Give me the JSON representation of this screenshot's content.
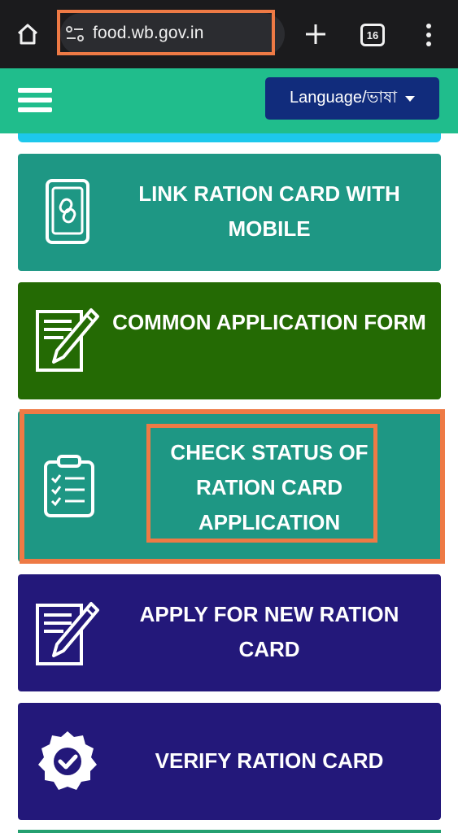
{
  "browser": {
    "url": "food.wb.gov.in",
    "tab_count": "16",
    "icons": {
      "home": "home-icon",
      "site_info": "site-settings-icon",
      "new_tab": "plus-icon",
      "tabs": "tab-switcher-icon",
      "menu": "more-vert-icon"
    }
  },
  "header": {
    "menu_icon": "hamburger-menu-icon",
    "language_button": "Language/ভাষা"
  },
  "cards": [
    {
      "label": "LINK RATION CARD WITH MOBILE",
      "icon": "mobile-link-icon",
      "color": "#1e9784"
    },
    {
      "label": "COMMON APPLICATION FORM",
      "icon": "form-pencil-icon",
      "color": "#246a04"
    },
    {
      "label": "CHECK STATUS OF RATION CARD APPLICATION",
      "icon": "clipboard-checklist-icon",
      "color": "#1e9784"
    },
    {
      "label": "APPLY FOR NEW RATION CARD",
      "icon": "form-pencil-icon",
      "color": "#23187a"
    },
    {
      "label": "VERIFY RATION CARD",
      "icon": "verified-badge-icon",
      "color": "#23187a"
    }
  ],
  "colors": {
    "header_green": "#20bd8c",
    "language_button": "#112c7c",
    "highlight_orange": "#ee7a45",
    "accent_cyan": "#1dc8ec"
  }
}
